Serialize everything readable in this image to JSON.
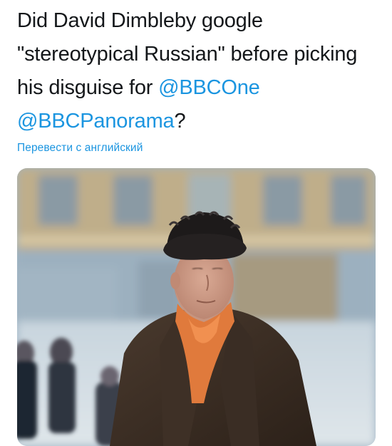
{
  "tweet": {
    "text_parts": {
      "p1": "Did David Dimbleby google \"stereotypical Russian\" before picking his disguise for ",
      "mention1": "@BBCOne",
      "space": " ",
      "mention2": "@BBCPanorama",
      "p2": "?"
    },
    "translate_label": "Перевести с английский",
    "media": {
      "description_icon": "photo-icon"
    }
  },
  "colors": {
    "text": "#14171a",
    "link": "#1b95e0",
    "background": "#ffffff"
  }
}
